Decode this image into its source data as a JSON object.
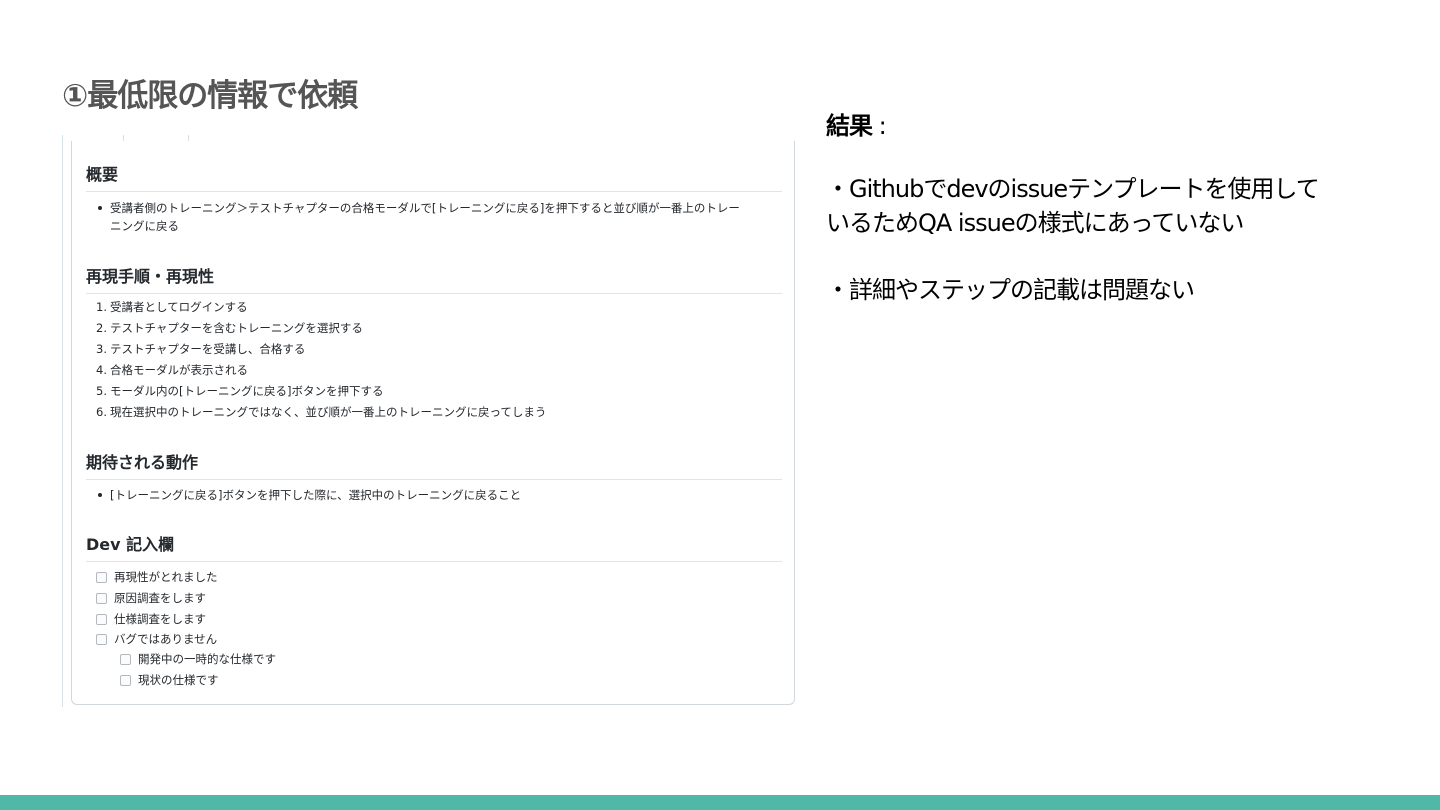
{
  "slide": {
    "title": "①最低限の情報で依頼",
    "result_label": "結果",
    "result_colon": ":",
    "result_lines": [
      "・Githubでdevのissueテンプレートを使用して",
      "いるためQA issueの様式にあっていない",
      "・詳細やステップの記載は問題ない"
    ]
  },
  "issue": {
    "summary": {
      "heading": "概要",
      "bullets": [
        "受講者側のトレーニング＞テストチャプターの合格モーダルで[トレーニングに戻る]を押下すると並び順が一番上のトレー",
        "ニングに戻る"
      ]
    },
    "repro": {
      "heading": "再現手順・再現性",
      "steps": [
        {
          "num": "1.",
          "text": "受講者としてログインする"
        },
        {
          "num": "2.",
          "text": "テストチャプターを含むトレーニングを選択する"
        },
        {
          "num": "3.",
          "text": "テストチャプターを受講し、合格する"
        },
        {
          "num": "4.",
          "text": "合格モーダルが表示される"
        },
        {
          "num": "5.",
          "text": "モーダル内の[トレーニングに戻る]ボタンを押下する"
        },
        {
          "num": "6.",
          "text": "現在選択中のトレーニングではなく、並び順が一番上のトレーニングに戻ってしまう"
        }
      ]
    },
    "expected": {
      "heading": "期待される動作",
      "bullets": [
        "[トレーニングに戻る]ボタンを押下した際に、選択中のトレーニングに戻ること"
      ]
    },
    "dev": {
      "heading": "Dev 記入欄",
      "tasks": [
        "再現性がとれました",
        "原因調査をします",
        "仕様調査をします",
        "バグではありません"
      ],
      "subtasks": [
        "開発中の一時的な仕様です",
        "現状の仕様です"
      ]
    }
  },
  "colors": {
    "footer_bar": "#4fb8a7",
    "title": "#555555"
  }
}
